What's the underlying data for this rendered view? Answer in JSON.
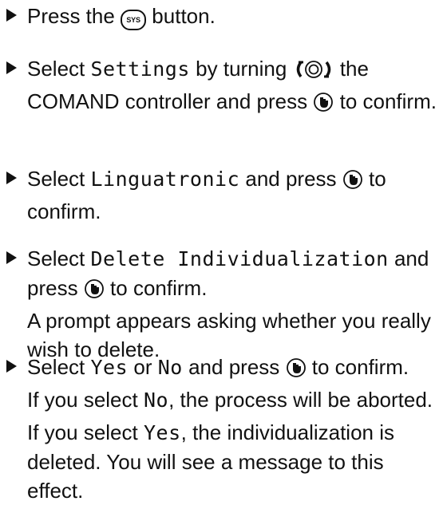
{
  "step1": {
    "pre": "Press the",
    "post": "button.",
    "button_icon_text": "SYS",
    "button_icon": "sys-button-icon"
  },
  "step2": {
    "pre": "Select",
    "item": "Settings",
    "mid": "by turning",
    "post": "the COMAND controller and press",
    "end": "to confirm.",
    "turn_icon": "turn-controller-icon",
    "press_icon": "press-controller-icon"
  },
  "step3": {
    "pre": "Select",
    "item": "Linguatronic",
    "mid": "and press",
    "end": "to confirm.",
    "press_icon": "press-controller-icon"
  },
  "step4": {
    "pre": "Select",
    "item": "Delete Individualization",
    "mid": "and press",
    "end": "to confirm.",
    "note": "A prompt appears asking whether you really wish to delete.",
    "press_icon": "press-controller-icon"
  },
  "step5": {
    "pre": "Select",
    "yes": "Yes",
    "or": "or",
    "no": "No",
    "mid": "and press",
    "end": "to confirm.",
    "note1_pre": "If you select",
    "note1_item": "No",
    "note1_post": ", the process will be aborted.",
    "note2_pre": "If you select",
    "note2_item": "Yes",
    "note2_post": ", the individualization is deleted. You will see a message to this effect.",
    "press_icon": "press-controller-icon"
  }
}
